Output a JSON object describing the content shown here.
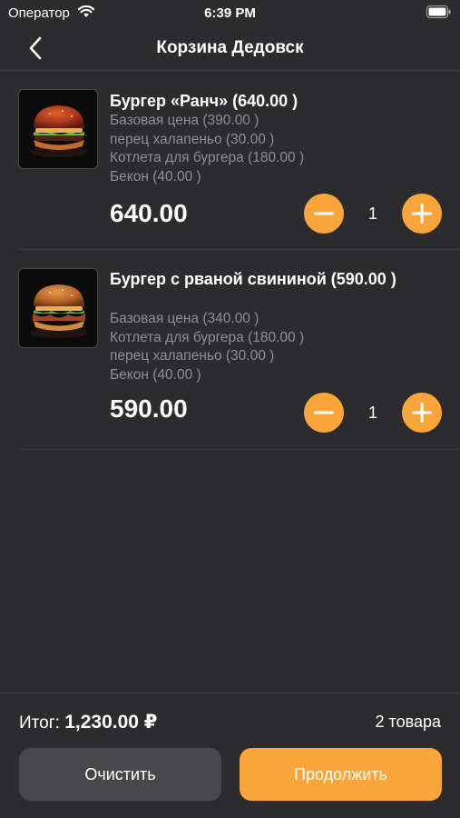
{
  "status_bar": {
    "carrier": "Оператор",
    "time": "6:39 PM",
    "icons": [
      "wifi-icon",
      "battery-icon"
    ]
  },
  "nav": {
    "title": "Корзина Дедовск",
    "back_icon": "chevron-left-icon"
  },
  "items": [
    {
      "name": "Бургер «Ранч» (640.00 )",
      "modifiers": [
        "Базовая цена (390.00 )",
        "перец халапеньо (30.00 )",
        "Котлета для бургера (180.00 )",
        "Бекон (40.00 )"
      ],
      "price": "640.00",
      "quantity": "1",
      "image": "burger-photo"
    },
    {
      "name": "Бургер с рваной свининой (590.00 )",
      "modifiers": [
        "Базовая цена (340.00 )",
        "Котлета для бургера (180.00 )",
        "перец халапеньо (30.00 )",
        "Бекон (40.00 )"
      ],
      "price": "590.00",
      "quantity": "1",
      "image": "burger-photo"
    }
  ],
  "footer": {
    "total_label": "Итог:",
    "total_value": "1,230.00 ₽",
    "count": "2 товара",
    "clear_label": "Очистить",
    "continue_label": "Продолжить"
  },
  "colors": {
    "background": "#2c2c2e",
    "accent": "#f9a53a",
    "secondary_text": "#8e8e93",
    "clear_button": "#48484a"
  }
}
